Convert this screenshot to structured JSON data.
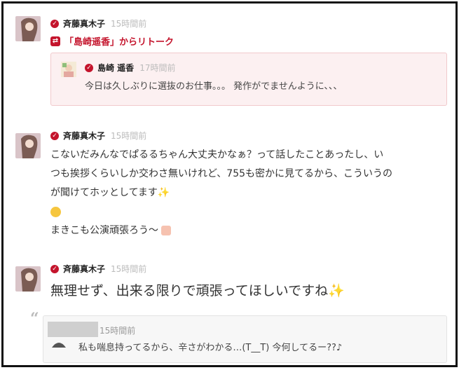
{
  "posts": [
    {
      "author": "斉藤真木子",
      "time": "15時間前",
      "retalk_label": "「島崎遥香」からリトーク",
      "retalk": {
        "author": "島崎 遥香",
        "time": "17時間前",
        "text": "今日は久しぶりに選抜のお仕事。。。 発作がでませんように、、、"
      }
    },
    {
      "author": "斉藤真木子",
      "time": "15時間前",
      "lines": [
        "こないだみんなでぱるるちゃん大丈夫かなぁ？って話したことあったし、い",
        "つも挨拶くらいしか交わさ無いけれど、755も密かに見てるから、こういうの",
        "が聞けてホッとしてます",
        "",
        "まきこも公演頑張ろう〜"
      ]
    },
    {
      "author": "斉藤真木子",
      "time": "15時間前",
      "big_text": "無理せず、出来る限りで頑張ってほしいですね",
      "reply": {
        "time": "15時間前",
        "text": "私も喘息持ってるから、辛さがわかる…(T__T) 今何してるー??♪"
      }
    }
  ],
  "icons": {
    "verified": "check-icon",
    "retalk": "retalk-icon",
    "quote": "quote-icon",
    "sparkle": "sparkle-icon",
    "smile": "smile-emoji-icon",
    "thumb": "thumbs-up-icon"
  },
  "colors": {
    "accent": "#c4142c",
    "retalk_bg": "#fcf0f1",
    "reply_bg": "#f7f7f7",
    "time": "#bbbbbb"
  }
}
